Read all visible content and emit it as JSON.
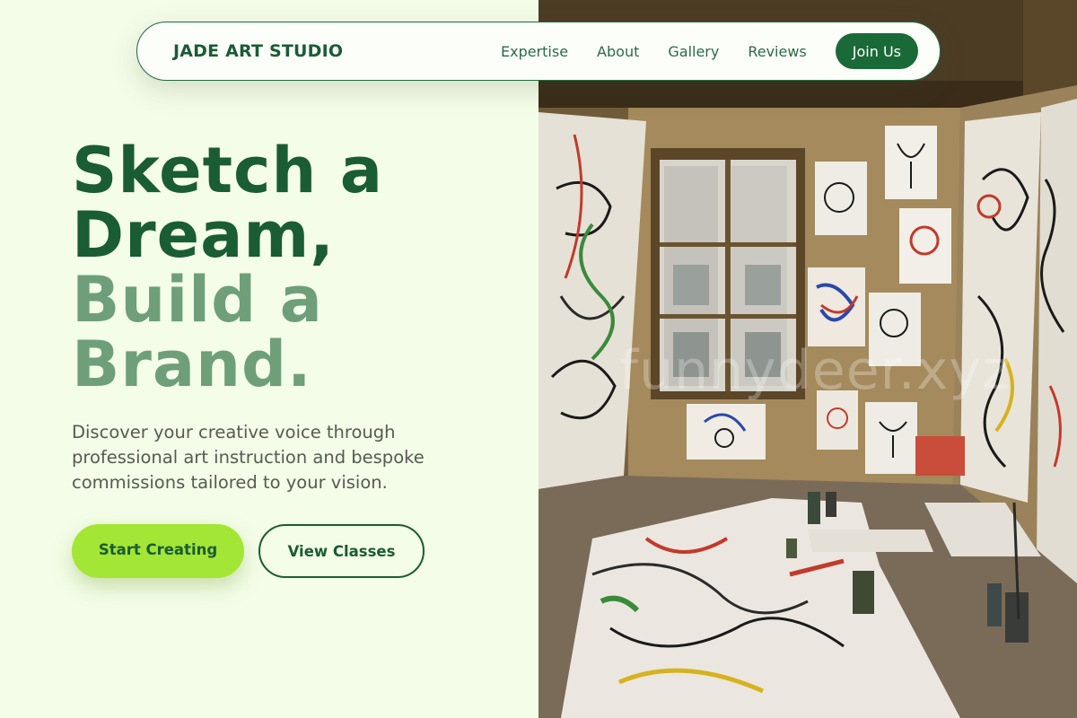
{
  "brand": "JADE ART STUDIO",
  "nav": {
    "links": [
      "Expertise",
      "About",
      "Gallery",
      "Reviews"
    ],
    "cta": "Join Us"
  },
  "hero": {
    "title_line1": "Sketch a",
    "title_line2": "Dream,",
    "title_line3": "Build a",
    "title_line4": "Brand.",
    "description": "Discover your creative voice through professional art instruction and bespoke commissions tailored to your vision.",
    "primary_button": "Start Creating",
    "secondary_button": "View Classes"
  },
  "photo": {
    "watermark": "funnydeer.xyz"
  },
  "colors": {
    "brand_green": "#1a5c34",
    "muted_green": "#6e9f7a",
    "lime_accent": "#a3e635",
    "background": "#f4fde8"
  }
}
